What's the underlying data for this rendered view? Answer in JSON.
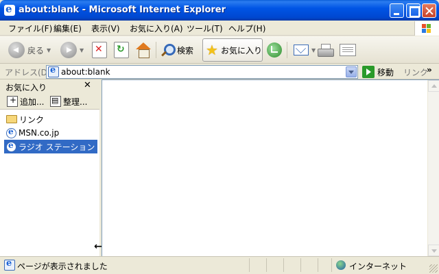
{
  "window": {
    "title": "about:blank - Microsoft Internet Explorer"
  },
  "menu": {
    "items": [
      {
        "label": "ファイル(F)"
      },
      {
        "label": "編集(E)"
      },
      {
        "label": "表示(V)"
      },
      {
        "label": "お気に入り(A)"
      },
      {
        "label": "ツール(T)"
      },
      {
        "label": "ヘルプ(H)"
      }
    ]
  },
  "toolbar": {
    "back_label": "戻る",
    "search_label": "検索",
    "favorites_label": "お気に入り"
  },
  "address": {
    "label": "アドレス(D)",
    "value": "about:blank",
    "go_label": "移動",
    "links_label": "リンク",
    "links_chevron": "»"
  },
  "favorites_pane": {
    "title": "お気に入り",
    "close": "✕",
    "add_label": "追加...",
    "organize_label": "整理...",
    "items": [
      {
        "label": "リンク",
        "type": "folder"
      },
      {
        "label": "MSN.co.jp",
        "type": "link"
      },
      {
        "label": "ラジオ ステーション ガ...",
        "type": "link",
        "selected": true
      }
    ]
  },
  "status": {
    "text": "ページが表示されました",
    "zone": "インターネット"
  },
  "colors": {
    "titlebar": "#0055e5",
    "selection": "#316ac5",
    "chrome": "#ece9d8"
  }
}
